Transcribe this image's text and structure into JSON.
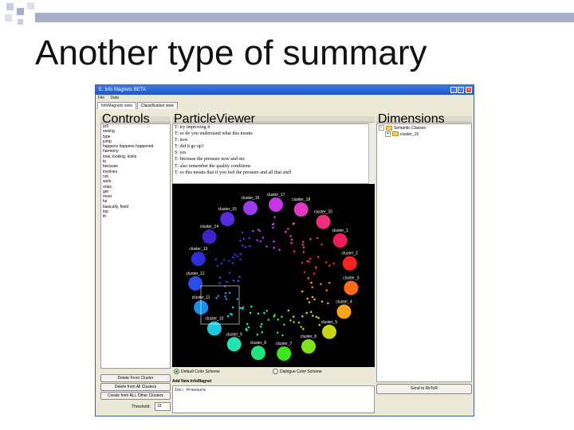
{
  "slide": {
    "title": "Another type of summary"
  },
  "window": {
    "title": "E. Info Magnets BETA",
    "menu": [
      "File",
      "Data"
    ],
    "tabs": [
      "InfoMagnets view",
      "Classification view"
    ],
    "panels": {
      "controls": "Controls",
      "particle_viewer": "ParticleViewer",
      "dimensions": "Dimensions"
    }
  },
  "controls_list": [
    "pr5",
    "seeing",
    "type",
    "jump",
    "happens happens happened",
    "harmony",
    "look, looking, looks",
    "to",
    "because",
    "involves",
    "not",
    "work",
    "relax",
    "get",
    "most",
    "fur",
    "basically, fixed",
    "top",
    "th"
  ],
  "controls_buttons": {
    "delete_from_cluster": "Delete From Cluster",
    "delete_from_all": "Delete from All Clusters",
    "create_from_all": "Create from ALL Other Clusters"
  },
  "threshold": {
    "label": "Threshold:",
    "value": "19"
  },
  "transcript": [
    "T: try improving it",
    "T: so do you understand what this means",
    "T: now",
    "T: did it go up?",
    "S: yes",
    "T: Increase the pressure now and see",
    "T: also remember the quality conditions",
    "T: so this means that if you feel the pressure and all that stuff"
  ],
  "clusters": [
    {
      "label": "cluster_16",
      "color": "#9b3cf0"
    },
    {
      "label": "cluster_17",
      "color": "#c636e6"
    },
    {
      "label": "cluster_18",
      "color": "#e438c4"
    },
    {
      "label": "cluster_20",
      "color": "#ee2f7e"
    },
    {
      "label": "cluster_1",
      "color": "#f11c5a"
    },
    {
      "label": "cluster_2",
      "color": "#f72323"
    },
    {
      "label": "cluster_3",
      "color": "#ff6d12"
    },
    {
      "label": "cluster_4",
      "color": "#f9a61a"
    },
    {
      "label": "cluster_5",
      "color": "#c7d41a"
    },
    {
      "label": "cluster_6",
      "color": "#80e21b"
    },
    {
      "label": "cluster_7",
      "color": "#3ee61c"
    },
    {
      "label": "cluster_8",
      "color": "#20e67a"
    },
    {
      "label": "cluster_9",
      "color": "#21e2b2"
    },
    {
      "label": "cluster_10",
      "color": "#1ec7e0"
    },
    {
      "label": "cluster_11",
      "color": "#1a8fe8"
    },
    {
      "label": "cluster_12",
      "color": "#2a4ce8"
    },
    {
      "label": "cluster_13",
      "color": "#2e2fd6"
    },
    {
      "label": "cluster_14",
      "color": "#3e22cc"
    },
    {
      "label": "cluster_15",
      "color": "#5a2adf"
    }
  ],
  "color_scheme": {
    "default": "Default Color Scheme",
    "dialogue": "Dialogue Color Scheme"
  },
  "add_new_label": "Add New InfoMagnet",
  "query_text": "Inc: Pressure",
  "send_button": "Send to ReToR",
  "tree": {
    "root": "Semantic Classes",
    "child": "cluster_19"
  }
}
